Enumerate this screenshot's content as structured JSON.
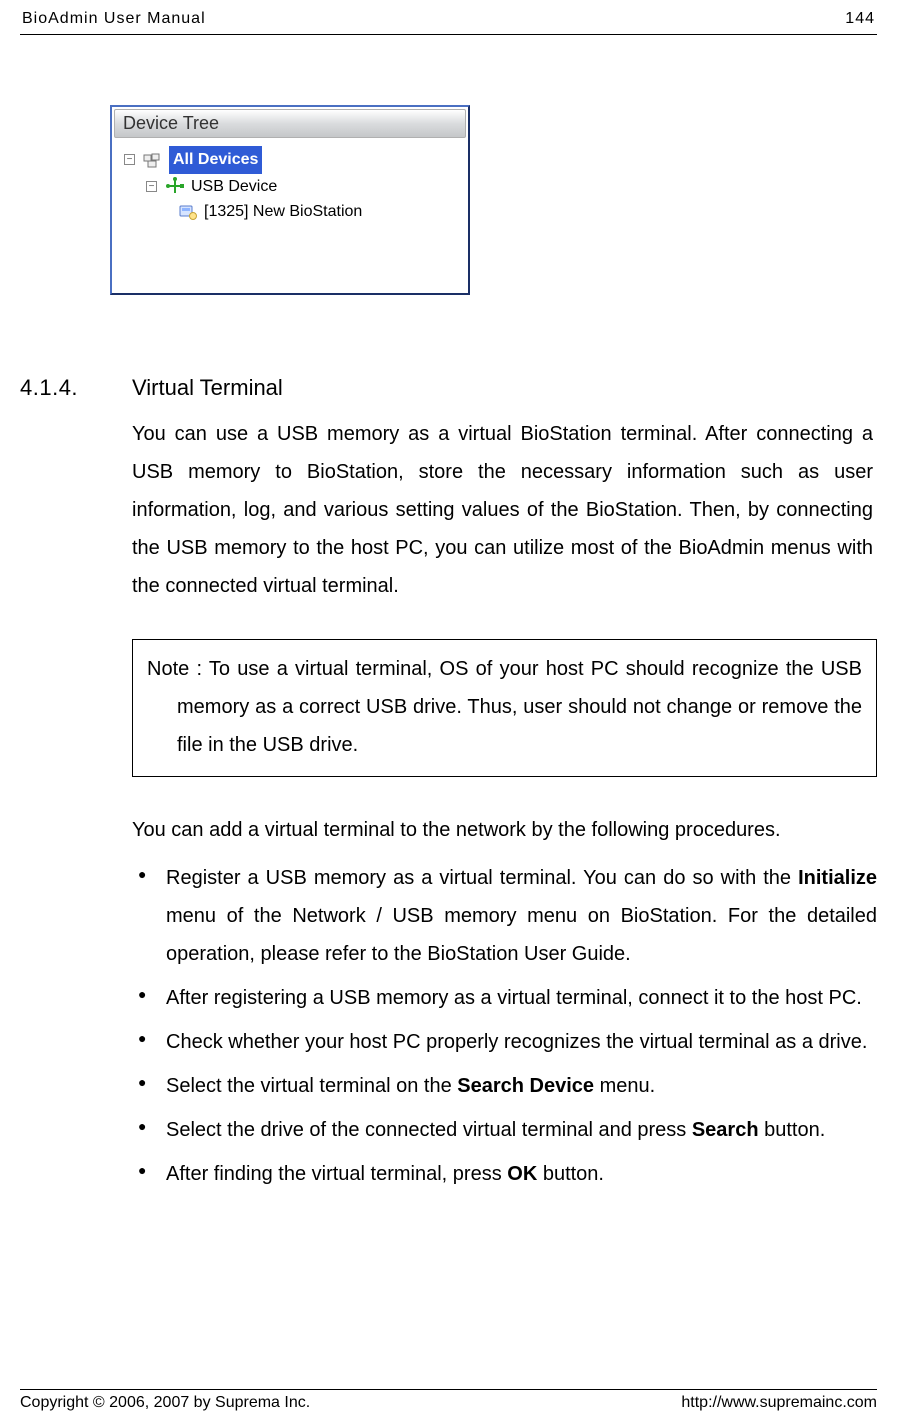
{
  "header": {
    "left": "BioAdmin User Manual",
    "right": "144"
  },
  "panel": {
    "title": "Device Tree",
    "root": {
      "label": "All Devices",
      "expander": "−"
    },
    "usb": {
      "label": "USB Device",
      "expander": "−"
    },
    "leaf": {
      "label": "[1325] New BioStation"
    }
  },
  "section": {
    "num": "4.1.4.",
    "title": "Virtual Terminal",
    "intro": "You can use a USB memory as a virtual BioStation terminal. After connecting a USB memory to BioStation, store the necessary information such as user information, log, and various setting values of the BioStation. Then, by connecting the USB memory to the host PC, you can utilize most of the BioAdmin menus with the connected virtual terminal.",
    "note": "Note : To use a virtual terminal, OS of your host PC should recognize the USB memory as a correct USB drive. Thus, user should not change or remove the file in the USB drive.",
    "lead": "You can add a virtual terminal to the network by the following procedures.",
    "bullets": {
      "b0a": "Register a USB memory as a virtual terminal. You can do so with the ",
      "b0b": "Initialize",
      "b0c": " menu of the Network / USB memory menu on BioStation. For the detailed operation, please refer to the BioStation User Guide.",
      "b1": "After registering a USB memory as a virtual terminal, connect it to the host PC.",
      "b2": "Check whether your host PC properly recognizes the virtual terminal as a drive.",
      "b3a": "Select the virtual terminal on the ",
      "b3b": "Search Device",
      "b3c": " menu.",
      "b4a": "Select the drive of the connected virtual terminal and press ",
      "b4b": "Search",
      "b4c": " button.",
      "b5a": "After finding the virtual terminal, press ",
      "b5b": "OK",
      "b5c": " button."
    }
  },
  "footer": {
    "left": "Copyright © 2006, 2007 by Suprema Inc.",
    "right": "http://www.supremainc.com"
  }
}
